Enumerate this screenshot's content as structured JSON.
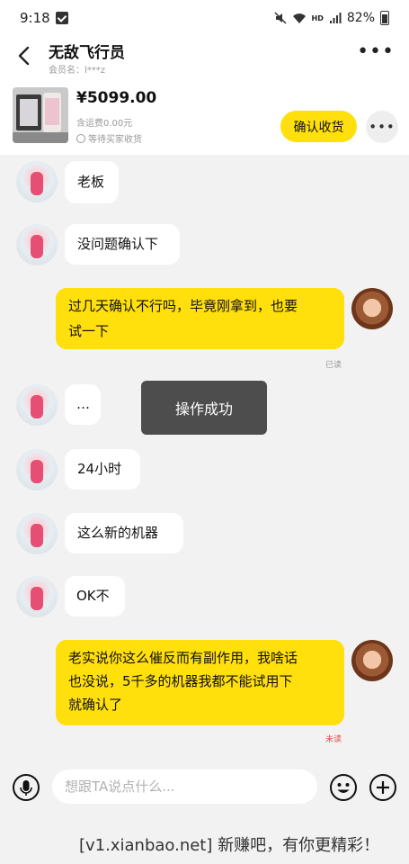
{
  "status_bar": {
    "time": "9:18",
    "battery": "82%"
  },
  "header": {
    "seller_name": "无敌飞行员",
    "member_label": "会员名：l***z"
  },
  "order": {
    "price": "¥5099.00",
    "shipping": "含运费0.00元",
    "status": "等待买家收货",
    "confirm_label": "确认收货"
  },
  "messages": [
    {
      "side": "left",
      "text": "老板"
    },
    {
      "side": "left",
      "text": "没问题确认下"
    },
    {
      "side": "right",
      "lines": [
        "过几天确认不行吗，毕竟刚拿到，也要",
        "试一下"
      ],
      "receipt": "已读"
    },
    {
      "side": "left",
      "text": "…"
    },
    {
      "side": "left",
      "text": "24小时"
    },
    {
      "side": "left",
      "text": "这么新的机器"
    },
    {
      "side": "left",
      "text": "OK不"
    },
    {
      "side": "right",
      "lines": [
        "老实说你这么催反而有副作用，我啥话",
        "也没说，5千多的机器我都不能试用下",
        "就确认了"
      ],
      "receipt": "未读"
    }
  ],
  "toast": "操作成功",
  "input": {
    "placeholder": "想跟TA说点什么..."
  },
  "watermark": "[v1.xianbao.net] 新赚吧，有你更精彩！"
}
